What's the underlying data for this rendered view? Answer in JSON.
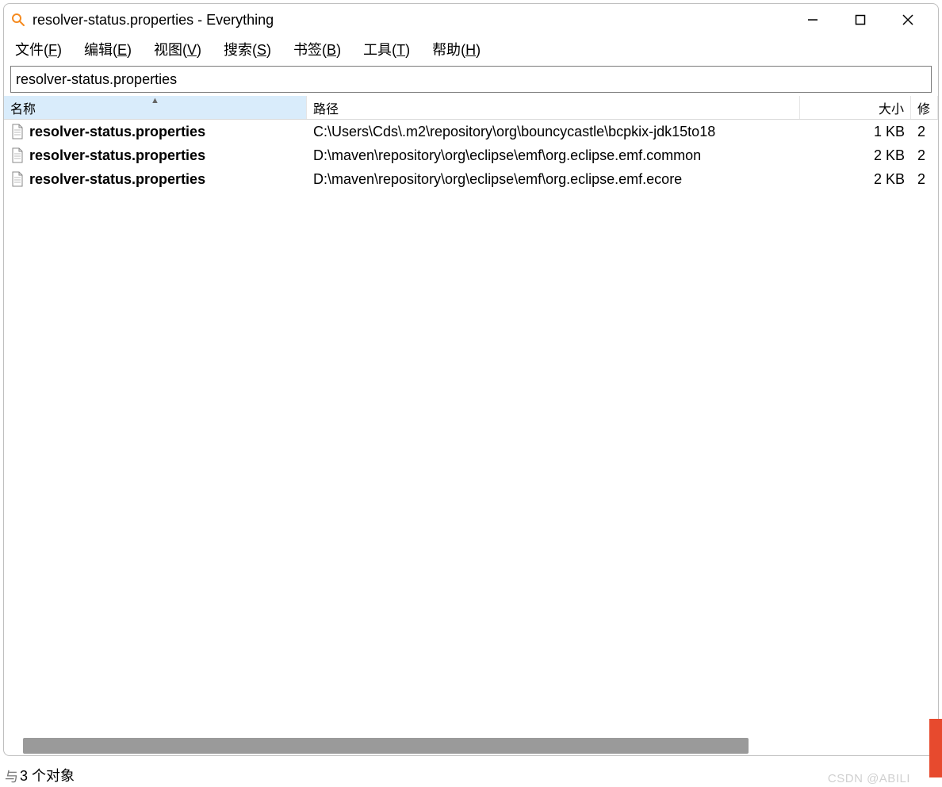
{
  "title": "resolver-status.properties - Everything",
  "menubar": [
    {
      "label": "文件",
      "hotkey": "F"
    },
    {
      "label": "编辑",
      "hotkey": "E"
    },
    {
      "label": "视图",
      "hotkey": "V"
    },
    {
      "label": "搜索",
      "hotkey": "S"
    },
    {
      "label": "书签",
      "hotkey": "B"
    },
    {
      "label": "工具",
      "hotkey": "T"
    },
    {
      "label": "帮助",
      "hotkey": "H"
    }
  ],
  "search_value": "resolver-status.properties",
  "columns": {
    "name": "名称",
    "path": "路径",
    "size": "大小",
    "extra": "修"
  },
  "sort_indicator": "▲",
  "rows": [
    {
      "name": "resolver-status.properties",
      "path": "C:\\Users\\Cds\\.m2\\repository\\org\\bouncycastle\\bcpkix-jdk15to18",
      "size": "1 KB",
      "extra": "2"
    },
    {
      "name": "resolver-status.properties",
      "path": "D:\\maven\\repository\\org\\eclipse\\emf\\org.eclipse.emf.common",
      "size": "2 KB",
      "extra": "2"
    },
    {
      "name": "resolver-status.properties",
      "path": "D:\\maven\\repository\\org\\eclipse\\emf\\org.eclipse.emf.ecore",
      "size": "2 KB",
      "extra": "2"
    }
  ],
  "status_leading": "与",
  "status_text": "3 个对象",
  "watermark": "CSDN @ABILI"
}
